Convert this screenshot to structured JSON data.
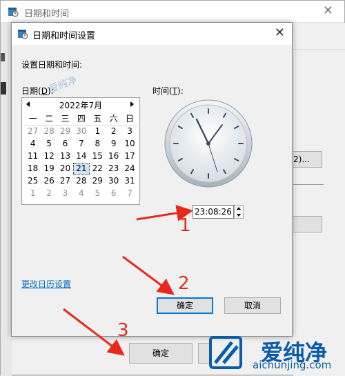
{
  "parent": {
    "title": "日期和时间",
    "right_button_text": "2)...",
    "ok": "确定"
  },
  "dialog": {
    "title": "日期和时间设置",
    "close": "✕",
    "heading": "设置日期和时间:",
    "date_label": "日期(",
    "date_key": "D",
    "date_label_end": "):",
    "time_label": "时间(",
    "time_key": "T",
    "time_label_end": "):",
    "calendar": {
      "month": "2022年7月",
      "weekdays": [
        "一",
        "二",
        "三",
        "四",
        "五",
        "六",
        "日"
      ],
      "weeks": [
        [
          "27",
          "28",
          "29",
          "30",
          "1",
          "2",
          "3"
        ],
        [
          "4",
          "5",
          "6",
          "7",
          "8",
          "9",
          "10"
        ],
        [
          "11",
          "12",
          "13",
          "14",
          "15",
          "16",
          "17"
        ],
        [
          "18",
          "19",
          "20",
          "21",
          "22",
          "23",
          "24"
        ],
        [
          "25",
          "26",
          "27",
          "28",
          "29",
          "30",
          "31"
        ],
        [
          "1",
          "2",
          "3",
          "4",
          "5",
          "6",
          "7"
        ]
      ],
      "selected": "21"
    },
    "time_value": "23:08:26",
    "change_calendar_link": "更改日历设置",
    "ok": "确定",
    "cancel": "取消"
  },
  "annotations": {
    "step1": "1",
    "step2": "2",
    "step3": "3",
    "arrow_color": "#e8281b"
  },
  "watermark": {
    "text": "爱纯净",
    "url": "aichunjing.com",
    "small": "爱纯净",
    "color": "#0a5cab"
  }
}
